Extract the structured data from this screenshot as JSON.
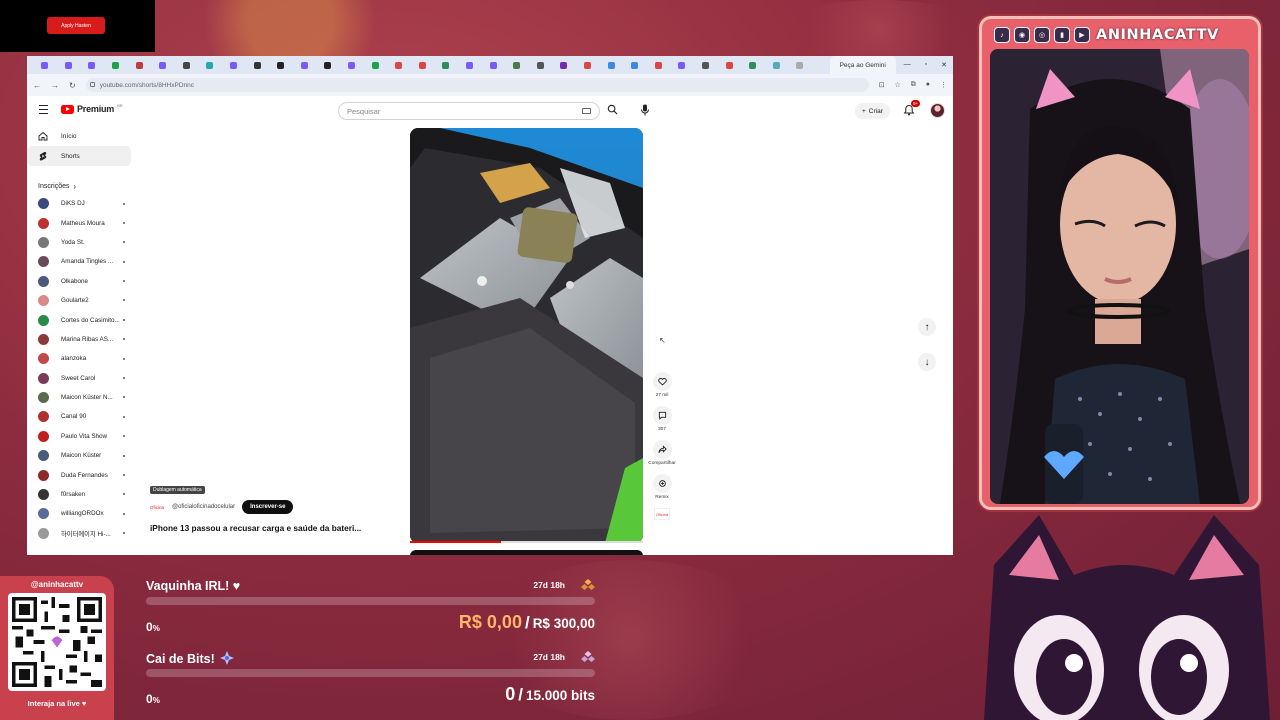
{
  "overlay": {
    "pill_text": "Apply Hasten"
  },
  "browser": {
    "gemini_tab": "Peça ao Gemini",
    "url": "youtube.com/shorts/8HHxPDnnc",
    "tab_colors": [
      "#7a5af8",
      "#7a5af8",
      "#7a5af8",
      "#1aa34a",
      "#c23b3b",
      "#7a5af8",
      "#444",
      "#2aa",
      "#7a5af8",
      "#333",
      "#222",
      "#7a5af8",
      "#222",
      "#7a5af8",
      "#1aa34a",
      "#d44",
      "#d44",
      "#2a8f5a",
      "#7a5af8",
      "#7a5af8",
      "#4a7a4a",
      "#555",
      "#7a2ab0",
      "#d44",
      "#3a8adf",
      "#3a8adf",
      "#d44",
      "#7a5af8",
      "#555",
      "#d44",
      "#2a8f5a",
      "#5ab",
      "#aaa"
    ]
  },
  "yt": {
    "logo": "Premium",
    "logo_sup": "BR",
    "search_placeholder": "Pesquisar",
    "create_label": "Criar",
    "notif_badge": "9+",
    "nav_home": "Início",
    "nav_shorts": "Shorts",
    "subs_title": "Inscrições",
    "subscriptions": [
      {
        "name": "DiKS DJ",
        "color": "#3a4a7a"
      },
      {
        "name": "Matheus Moura",
        "color": "#c03030"
      },
      {
        "name": "Yoda St.",
        "color": "#777"
      },
      {
        "name": "Amanda Tingles ...",
        "color": "#6a4a5a"
      },
      {
        "name": "Olkabone",
        "color": "#4a5a7a"
      },
      {
        "name": "Goularte2",
        "color": "#d88a8a"
      },
      {
        "name": "Cortes do Casimito...",
        "color": "#2a8a4a"
      },
      {
        "name": "Marina Ribas AS...",
        "color": "#8a3a3a"
      },
      {
        "name": "alanzoka",
        "color": "#c04a4a"
      },
      {
        "name": "Sweet Carol",
        "color": "#7a3a5a"
      },
      {
        "name": "Maicon Küster N...",
        "color": "#5a6a4a"
      },
      {
        "name": "Canal 90",
        "color": "#b03030"
      },
      {
        "name": "Paulo Vita Show",
        "color": "#c02020"
      },
      {
        "name": "Maicon Küster",
        "color": "#4a5a7a"
      },
      {
        "name": "Duda Fernandes",
        "color": "#8a2a2a"
      },
      {
        "name": "f0rsaken",
        "color": "#333"
      },
      {
        "name": "williangORDOx",
        "color": "#5a6a9a"
      },
      {
        "name": "하이터에이지 Hi-...",
        "color": "#999"
      }
    ],
    "dub_tag": "Dublagem automática",
    "channel_logo": "Oficina",
    "channel_handle": "@oficialoficinadocelular",
    "subscribe_label": "Inscrever-se",
    "video_title": "iPhone 13 passou a recusar carga e saúde da bateri...",
    "likes": "27 mil",
    "comments": "307",
    "share_label": "Compartilhar",
    "remix_label": "Remix",
    "progress_fraction": 0.39
  },
  "webcam": {
    "channel_name": "ANINHACATTV",
    "social_icons": [
      "tiktok-icon",
      "discord-icon",
      "instagram-icon",
      "twitch-icon",
      "youtube-icon"
    ]
  },
  "qr": {
    "handle": "@aninhacattv",
    "live_text": "Interaja na live ♥"
  },
  "goals": [
    {
      "title": "Vaquinha IRL! ♥",
      "time": "27d 18h",
      "percent": "0",
      "percent_unit": "%",
      "current": "R$ 0,00",
      "separator": "/",
      "target": "R$ 300,00",
      "progress_fraction": 0
    },
    {
      "title": "Cai de Bits!",
      "time": "27d 18h",
      "percent": "0",
      "percent_unit": "%",
      "current": "0",
      "separator": "/",
      "target": "15.000 bits",
      "progress_fraction": 0
    }
  ]
}
